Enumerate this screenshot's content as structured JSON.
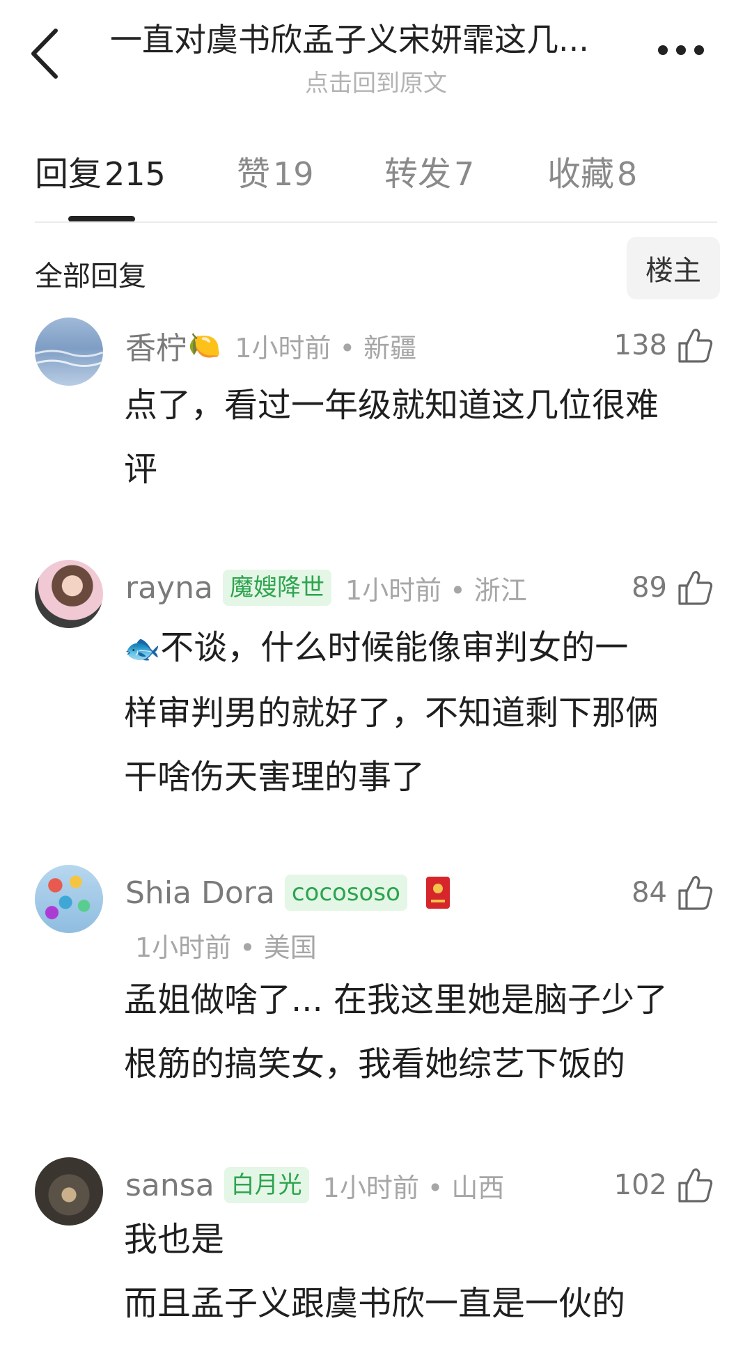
{
  "header": {
    "title": "一直对虞书欣孟子义宋妍霏这几...",
    "subtitle": "点击回到原文"
  },
  "tabs": [
    {
      "label": "回复",
      "count": "215",
      "active": true
    },
    {
      "label": "赞",
      "count": "19"
    },
    {
      "label": "转发",
      "count": "7"
    },
    {
      "label": "收藏",
      "count": "8"
    }
  ],
  "section": {
    "title": "全部回复",
    "louzhu_label": "楼主"
  },
  "comments": [
    {
      "name": "香柠",
      "emoji": "🍋",
      "badge": "",
      "time": "1小时前 • 新疆",
      "likes": "138",
      "lines": [
        "点了，看过一年级就知道这几位很难",
        "评"
      ]
    },
    {
      "name": "rayna",
      "badge": "魔嫂降世",
      "time": "1小时前 • 浙江",
      "likes": "89",
      "emoji": "🐟",
      "lines": [
        "不谈，什么时候能像审判女的一",
        "样审判男的就好了，不知道剩下那俩",
        "干啥伤天害理的事了"
      ]
    },
    {
      "name": "Shia Dora",
      "badge": "cocososo",
      "time": "1小时前 • 美国",
      "likes": "84",
      "lines": [
        "孟姐做啥了... 在我这里她是脑子少了",
        "根筋的搞笑女，我看她综艺下饭的"
      ]
    },
    {
      "name": "sansa",
      "badge": "白月光",
      "time": "1小时前 • 山西",
      "likes": "102",
      "lines": [
        "我也是",
        "而且孟子义跟虞书欣一直是一伙的"
      ]
    }
  ],
  "colors": {
    "badge_green": "#2da44e",
    "badge_bg": "#e4f6e6",
    "muted": "#a6a6a6"
  },
  "icons": [
    "back-arrow-icon",
    "more-dots-icon",
    "thumbs-up-icon",
    "lemon-icon",
    "fish-icon",
    "red-packet-icon"
  ]
}
